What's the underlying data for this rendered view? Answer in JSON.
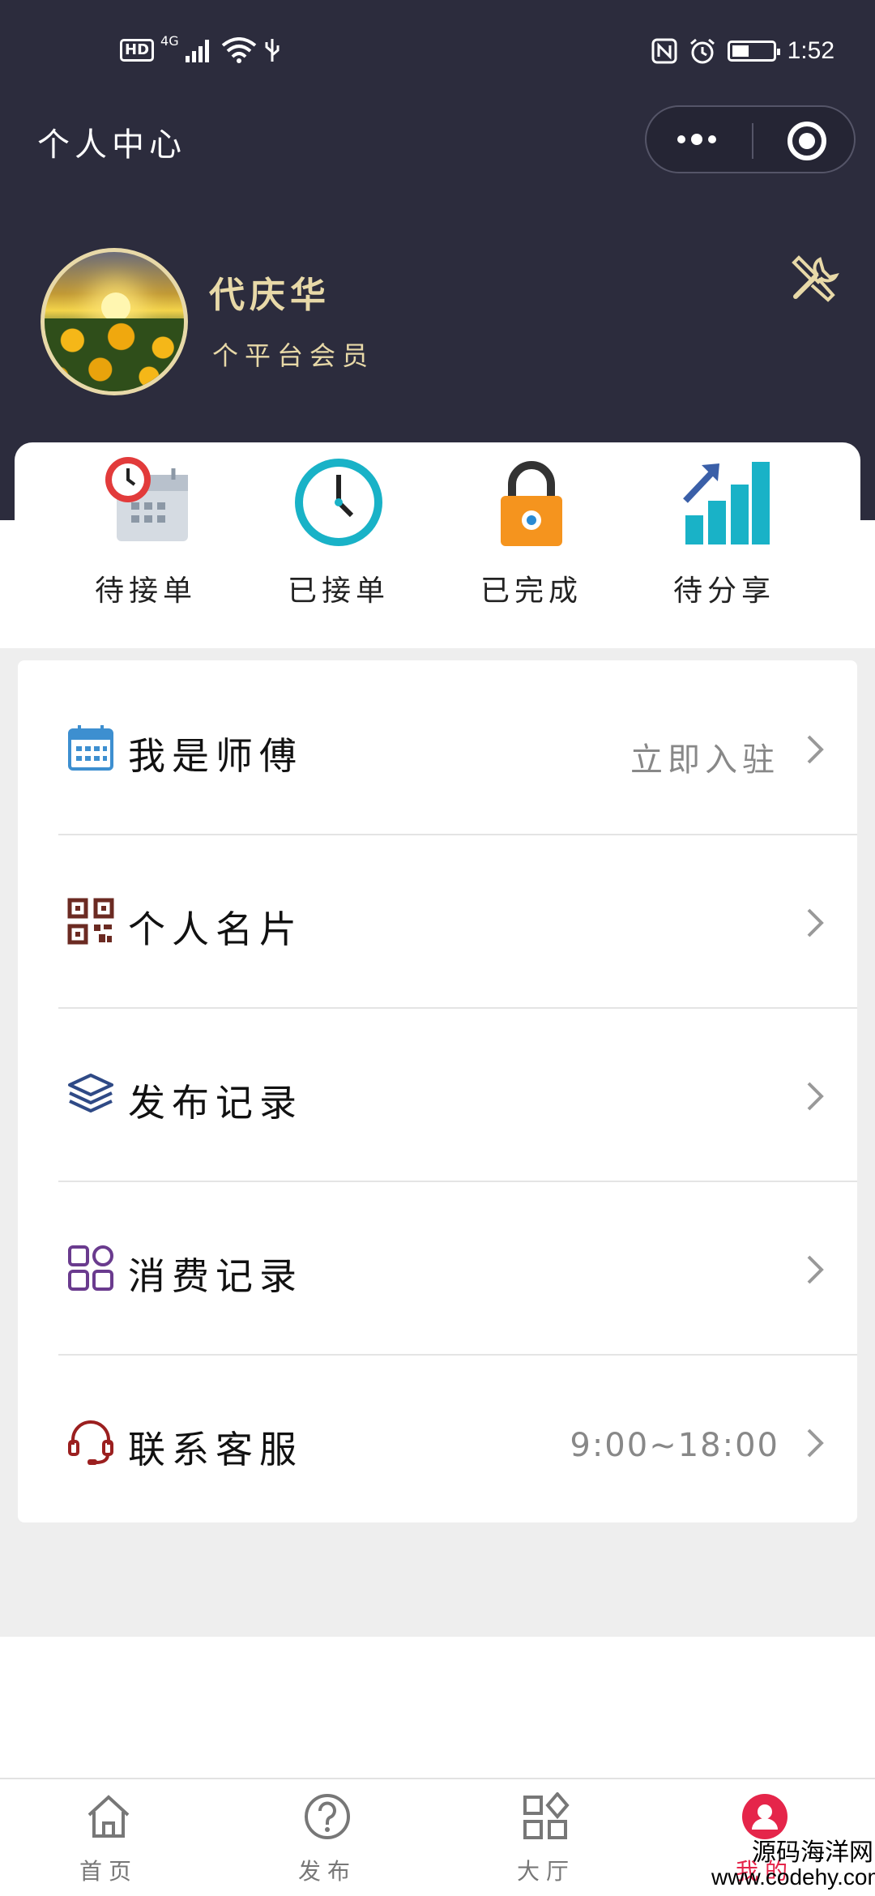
{
  "status_bar": {
    "left_indicators": "HD",
    "network": "4G",
    "time": "1:52"
  },
  "header": {
    "title": "个人中心"
  },
  "profile": {
    "name": "代庆华",
    "role": "个平台会员"
  },
  "orders": {
    "items": [
      {
        "label": "待接单",
        "icon": "calendar-clock-icon"
      },
      {
        "label": "已接单",
        "icon": "clock-icon"
      },
      {
        "label": "已完成",
        "icon": "lock-icon"
      },
      {
        "label": "待分享",
        "icon": "growth-chart-icon"
      }
    ]
  },
  "menu": {
    "items": [
      {
        "label": "我是师傅",
        "extra": "立即入驻",
        "icon": "calendar-icon",
        "color": "#3d8fd0"
      },
      {
        "label": "个人名片",
        "extra": "",
        "icon": "qr-code-icon",
        "color": "#6b2a22"
      },
      {
        "label": "发布记录",
        "extra": "",
        "icon": "layers-icon",
        "color": "#2f4a86"
      },
      {
        "label": "消费记录",
        "extra": "",
        "icon": "grid-apps-icon",
        "color": "#6a3b8e"
      },
      {
        "label": "联系客服",
        "extra": "9:00~18:00",
        "icon": "headset-icon",
        "color": "#9b1f1f"
      }
    ]
  },
  "bottom_nav": {
    "items": [
      {
        "label": "首页",
        "icon": "home-icon"
      },
      {
        "label": "发布",
        "icon": "question-icon"
      },
      {
        "label": "大厅",
        "icon": "apps-icon"
      },
      {
        "label": "我的",
        "icon": "user-icon",
        "active": true
      }
    ]
  },
  "watermark": {
    "line1": "源码海洋网",
    "line2": "www.codehy.com"
  },
  "colors": {
    "header_bg": "#2c2c3d",
    "accent_gold": "#e8d9a8",
    "active_red": "#e5254a"
  }
}
